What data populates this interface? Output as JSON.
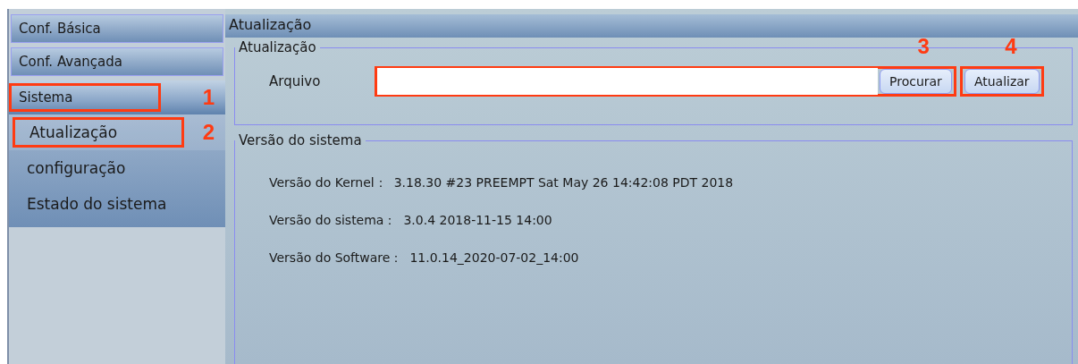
{
  "sidebar": {
    "sections": [
      {
        "label": "Conf. Básica",
        "expanded": false
      },
      {
        "label": "Conf. Avançada",
        "expanded": false
      },
      {
        "label": "Sistema",
        "expanded": true,
        "callout": "1",
        "children": [
          {
            "label": "Atualização",
            "selected": true,
            "callout": "2"
          },
          {
            "label": "configuração",
            "selected": false
          },
          {
            "label": "Estado do sistema",
            "selected": false
          }
        ]
      }
    ]
  },
  "panel": {
    "title": "Atualização",
    "update_group": {
      "title": "Atualização",
      "file_label": "Arquivo",
      "browse_button": "Procurar",
      "browse_callout": "3",
      "update_button": "Atualizar",
      "update_callout": "4"
    },
    "version_group": {
      "title": "Versão do sistema",
      "rows": [
        {
          "label": "Versão do Kernel：",
          "value": "3.18.30 #23 PREEMPT Sat May 26 14:42:08 PDT 2018"
        },
        {
          "label": "Versão do sistema：",
          "value": "3.0.4 2018-11-15 14:00"
        },
        {
          "label": "Versão do Software：",
          "value": "11.0.14_2020-07-02_14:00"
        }
      ]
    }
  }
}
